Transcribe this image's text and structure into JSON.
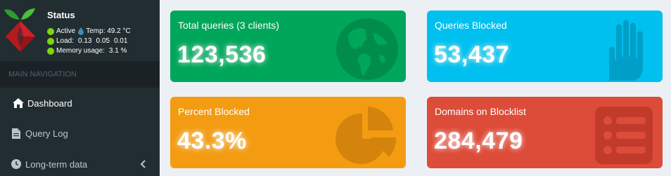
{
  "sidebar": {
    "status": {
      "title": "Status",
      "active": "Active",
      "temp_label": "Temp: 49.2 °C",
      "load_label": "Load:",
      "load_1": "0.13",
      "load_5": "0.05",
      "load_15": "0.01",
      "memory_label": "Memory usage:",
      "memory_value": "3.1 %",
      "indicator_color": "#7fd60a"
    },
    "nav_header": "MAIN NAVIGATION",
    "items": [
      {
        "label": "Dashboard",
        "icon": "home-icon"
      },
      {
        "label": "Query Log",
        "icon": "file-icon"
      },
      {
        "label": "Long-term data",
        "icon": "clock-icon"
      }
    ]
  },
  "cards": [
    {
      "label": "Total queries (3 clients)",
      "value": "123,536",
      "color": "#00a65a",
      "icon": "globe-icon"
    },
    {
      "label": "Queries Blocked",
      "value": "53,437",
      "color": "#00c0ef",
      "icon": "hand-icon"
    },
    {
      "label": "Percent Blocked",
      "value": "43.3%",
      "color": "#f39c12",
      "icon": "pie-chart-icon"
    },
    {
      "label": "Domains on Blocklist",
      "value": "284,479",
      "color": "#dd4b39",
      "icon": "list-icon"
    }
  ]
}
